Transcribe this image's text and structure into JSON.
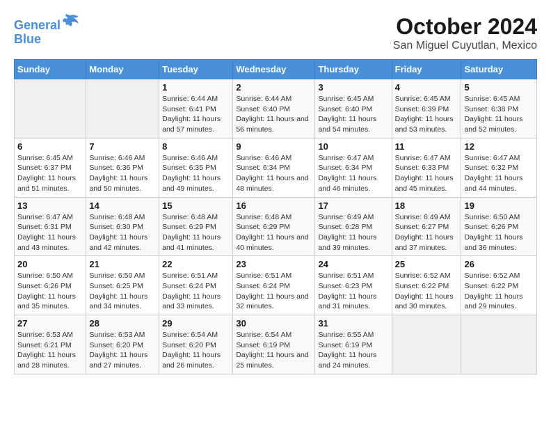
{
  "logo": {
    "line1": "General",
    "line2": "Blue"
  },
  "title": "October 2024",
  "subtitle": "San Miguel Cuyutlan, Mexico",
  "weekdays": [
    "Sunday",
    "Monday",
    "Tuesday",
    "Wednesday",
    "Thursday",
    "Friday",
    "Saturday"
  ],
  "weeks": [
    [
      {
        "day": "",
        "empty": true
      },
      {
        "day": "",
        "empty": true
      },
      {
        "day": "1",
        "sunrise": "Sunrise: 6:44 AM",
        "sunset": "Sunset: 6:41 PM",
        "daylight": "Daylight: 11 hours and 57 minutes."
      },
      {
        "day": "2",
        "sunrise": "Sunrise: 6:44 AM",
        "sunset": "Sunset: 6:40 PM",
        "daylight": "Daylight: 11 hours and 56 minutes."
      },
      {
        "day": "3",
        "sunrise": "Sunrise: 6:45 AM",
        "sunset": "Sunset: 6:40 PM",
        "daylight": "Daylight: 11 hours and 54 minutes."
      },
      {
        "day": "4",
        "sunrise": "Sunrise: 6:45 AM",
        "sunset": "Sunset: 6:39 PM",
        "daylight": "Daylight: 11 hours and 53 minutes."
      },
      {
        "day": "5",
        "sunrise": "Sunrise: 6:45 AM",
        "sunset": "Sunset: 6:38 PM",
        "daylight": "Daylight: 11 hours and 52 minutes."
      }
    ],
    [
      {
        "day": "6",
        "sunrise": "Sunrise: 6:45 AM",
        "sunset": "Sunset: 6:37 PM",
        "daylight": "Daylight: 11 hours and 51 minutes."
      },
      {
        "day": "7",
        "sunrise": "Sunrise: 6:46 AM",
        "sunset": "Sunset: 6:36 PM",
        "daylight": "Daylight: 11 hours and 50 minutes."
      },
      {
        "day": "8",
        "sunrise": "Sunrise: 6:46 AM",
        "sunset": "Sunset: 6:35 PM",
        "daylight": "Daylight: 11 hours and 49 minutes."
      },
      {
        "day": "9",
        "sunrise": "Sunrise: 6:46 AM",
        "sunset": "Sunset: 6:34 PM",
        "daylight": "Daylight: 11 hours and 48 minutes."
      },
      {
        "day": "10",
        "sunrise": "Sunrise: 6:47 AM",
        "sunset": "Sunset: 6:34 PM",
        "daylight": "Daylight: 11 hours and 46 minutes."
      },
      {
        "day": "11",
        "sunrise": "Sunrise: 6:47 AM",
        "sunset": "Sunset: 6:33 PM",
        "daylight": "Daylight: 11 hours and 45 minutes."
      },
      {
        "day": "12",
        "sunrise": "Sunrise: 6:47 AM",
        "sunset": "Sunset: 6:32 PM",
        "daylight": "Daylight: 11 hours and 44 minutes."
      }
    ],
    [
      {
        "day": "13",
        "sunrise": "Sunrise: 6:47 AM",
        "sunset": "Sunset: 6:31 PM",
        "daylight": "Daylight: 11 hours and 43 minutes."
      },
      {
        "day": "14",
        "sunrise": "Sunrise: 6:48 AM",
        "sunset": "Sunset: 6:30 PM",
        "daylight": "Daylight: 11 hours and 42 minutes."
      },
      {
        "day": "15",
        "sunrise": "Sunrise: 6:48 AM",
        "sunset": "Sunset: 6:29 PM",
        "daylight": "Daylight: 11 hours and 41 minutes."
      },
      {
        "day": "16",
        "sunrise": "Sunrise: 6:48 AM",
        "sunset": "Sunset: 6:29 PM",
        "daylight": "Daylight: 11 hours and 40 minutes."
      },
      {
        "day": "17",
        "sunrise": "Sunrise: 6:49 AM",
        "sunset": "Sunset: 6:28 PM",
        "daylight": "Daylight: 11 hours and 39 minutes."
      },
      {
        "day": "18",
        "sunrise": "Sunrise: 6:49 AM",
        "sunset": "Sunset: 6:27 PM",
        "daylight": "Daylight: 11 hours and 37 minutes."
      },
      {
        "day": "19",
        "sunrise": "Sunrise: 6:50 AM",
        "sunset": "Sunset: 6:26 PM",
        "daylight": "Daylight: 11 hours and 36 minutes."
      }
    ],
    [
      {
        "day": "20",
        "sunrise": "Sunrise: 6:50 AM",
        "sunset": "Sunset: 6:26 PM",
        "daylight": "Daylight: 11 hours and 35 minutes."
      },
      {
        "day": "21",
        "sunrise": "Sunrise: 6:50 AM",
        "sunset": "Sunset: 6:25 PM",
        "daylight": "Daylight: 11 hours and 34 minutes."
      },
      {
        "day": "22",
        "sunrise": "Sunrise: 6:51 AM",
        "sunset": "Sunset: 6:24 PM",
        "daylight": "Daylight: 11 hours and 33 minutes."
      },
      {
        "day": "23",
        "sunrise": "Sunrise: 6:51 AM",
        "sunset": "Sunset: 6:24 PM",
        "daylight": "Daylight: 11 hours and 32 minutes."
      },
      {
        "day": "24",
        "sunrise": "Sunrise: 6:51 AM",
        "sunset": "Sunset: 6:23 PM",
        "daylight": "Daylight: 11 hours and 31 minutes."
      },
      {
        "day": "25",
        "sunrise": "Sunrise: 6:52 AM",
        "sunset": "Sunset: 6:22 PM",
        "daylight": "Daylight: 11 hours and 30 minutes."
      },
      {
        "day": "26",
        "sunrise": "Sunrise: 6:52 AM",
        "sunset": "Sunset: 6:22 PM",
        "daylight": "Daylight: 11 hours and 29 minutes."
      }
    ],
    [
      {
        "day": "27",
        "sunrise": "Sunrise: 6:53 AM",
        "sunset": "Sunset: 6:21 PM",
        "daylight": "Daylight: 11 hours and 28 minutes."
      },
      {
        "day": "28",
        "sunrise": "Sunrise: 6:53 AM",
        "sunset": "Sunset: 6:20 PM",
        "daylight": "Daylight: 11 hours and 27 minutes."
      },
      {
        "day": "29",
        "sunrise": "Sunrise: 6:54 AM",
        "sunset": "Sunset: 6:20 PM",
        "daylight": "Daylight: 11 hours and 26 minutes."
      },
      {
        "day": "30",
        "sunrise": "Sunrise: 6:54 AM",
        "sunset": "Sunset: 6:19 PM",
        "daylight": "Daylight: 11 hours and 25 minutes."
      },
      {
        "day": "31",
        "sunrise": "Sunrise: 6:55 AM",
        "sunset": "Sunset: 6:19 PM",
        "daylight": "Daylight: 11 hours and 24 minutes."
      },
      {
        "day": "",
        "empty": true
      },
      {
        "day": "",
        "empty": true
      }
    ]
  ]
}
